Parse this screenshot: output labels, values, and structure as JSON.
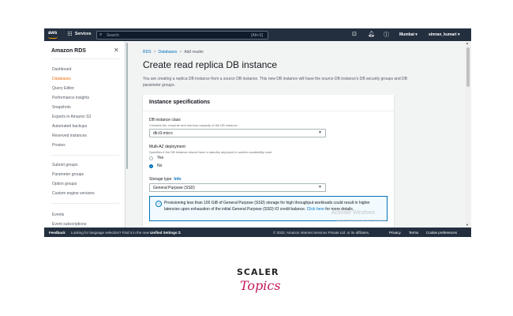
{
  "topbar": {
    "logo": "aws",
    "services": "Services",
    "search_placeholder": "Search",
    "search_shortcut": "[Alt+S]",
    "region": "Mumbai ▾",
    "user": "simran_kumari ▾"
  },
  "sidebar": {
    "title": "Amazon RDS",
    "items": [
      {
        "label": "Dashboard"
      },
      {
        "label": "Databases",
        "active": true
      },
      {
        "label": "Query Editor"
      },
      {
        "label": "Performance insights"
      },
      {
        "label": "Snapshots"
      },
      {
        "label": "Exports in Amazon S3"
      },
      {
        "label": "Automated backups"
      },
      {
        "label": "Reserved instances"
      },
      {
        "label": "Proxies"
      },
      {
        "label": "Subnet groups"
      },
      {
        "label": "Parameter groups"
      },
      {
        "label": "Option groups"
      },
      {
        "label": "Custom engine versions"
      },
      {
        "label": "Events"
      },
      {
        "label": "Event subscriptions"
      }
    ]
  },
  "breadcrumb": {
    "items": [
      "RDS",
      "Databases",
      "Add reader"
    ],
    "sep": ">"
  },
  "page": {
    "title": "Create read replica DB instance",
    "description": "You are creating a replica DB instance from a source DB instance. This new DB instance will have the source DB instance's DB security groups and DB parameter groups."
  },
  "instance_specs": {
    "heading": "Instance specifications",
    "db_class_label": "DB instance class",
    "db_class_desc": "Contains the compute and memory capacity of the DB instance.",
    "db_class_value": "db.t3.micro",
    "multi_az_label": "Multi-AZ deployment",
    "multi_az_desc": "Specifies if the DB instance should have a standby deployed in another availability zone.",
    "multi_az_options": [
      {
        "label": "Yes",
        "selected": false
      },
      {
        "label": "No",
        "selected": true
      }
    ],
    "storage_label": "Storage type",
    "storage_info": "Info",
    "storage_value": "General Purpose (SSD)",
    "alert_text": "Provisioning less than 100 GiB of General Purpose (SSD) storage for high throughput workloads could result in higher latencies upon exhaustion of the initial General Purpose (SSD) IO credit balance.",
    "alert_link": "Click here",
    "alert_tail": "for more details."
  },
  "watermark": {
    "line1": "Activate Windows",
    "line2": "Go to Settings to activate Windows."
  },
  "footer": {
    "feedback": "Feedback",
    "language_prefix": "Looking for language selection? Find it in the new",
    "language_link": "Unified Settings",
    "copyright": "© 2022, Amazon Internet Services Private Ltd. or its affiliates.",
    "privacy": "Privacy",
    "terms": "Terms",
    "cookies": "Cookie preferences"
  },
  "branding": {
    "line1": "SCALER",
    "line2": "Topics"
  },
  "colors": {
    "aws_navy": "#232f3e",
    "link_blue": "#0073bb",
    "active_orange": "#ec7211",
    "brand_pink": "#c2185b"
  }
}
